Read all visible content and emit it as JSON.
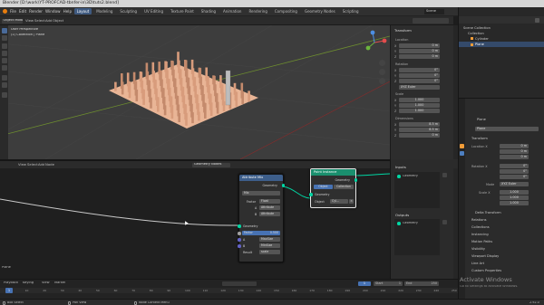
{
  "window": {
    "title": "Blender [D:\\work\\YT-PROFCAD-tbnfer-in\\3D\\tuts2.blend]"
  },
  "menubar": {
    "items": [
      "File",
      "Edit",
      "Render",
      "Window",
      "Help"
    ],
    "workspaces": [
      "Layout",
      "Modeling",
      "Sculpting",
      "UV Editing",
      "Texture Paint",
      "Shading",
      "Animation",
      "Rendering",
      "Compositing",
      "Geometry Nodes",
      "Scripting"
    ],
    "active_workspace": "Layout",
    "scene": "Scene",
    "view_layer": "View Layer"
  },
  "viewport": {
    "mode": "Object Mode",
    "menus": [
      "View",
      "Select",
      "Add",
      "Object"
    ],
    "overlay_title": "User Perspective",
    "overlay_subtitle": "(1) Collection | Plane"
  },
  "npanel": {
    "header": "Transform",
    "location_label": "Location",
    "location": [
      {
        "axis": "X",
        "value": "0 m"
      },
      {
        "axis": "Y",
        "value": "0 m"
      },
      {
        "axis": "Z",
        "value": "0 m"
      }
    ],
    "rotation_label": "Rotation",
    "rotation": [
      {
        "axis": "X",
        "value": "0°"
      },
      {
        "axis": "Y",
        "value": "0°"
      },
      {
        "axis": "Z",
        "value": "0°"
      }
    ],
    "rotation_mode": "XYZ Euler",
    "scale_label": "Scale",
    "scale": [
      {
        "axis": "X",
        "value": "1.000"
      },
      {
        "axis": "Y",
        "value": "1.000"
      },
      {
        "axis": "Z",
        "value": "1.000"
      }
    ],
    "dimensions_label": "Dimensions",
    "dimensions": [
      {
        "axis": "X",
        "value": "8.5 m"
      },
      {
        "axis": "Y",
        "value": "8.5 m"
      },
      {
        "axis": "Z",
        "value": "0 m"
      }
    ]
  },
  "outliner": {
    "items": [
      "Scene Collection",
      "Collection",
      "Cylinder",
      "Plane"
    ],
    "selected": "Plane"
  },
  "properties": {
    "object_name": "Plane",
    "data_name": "Plane",
    "transform_header": "Transform",
    "location_label": "Location X",
    "location": [
      "0 m",
      "0 m",
      "0 m"
    ],
    "rotation_label": "Rotation X",
    "rotation": [
      "0°",
      "0°",
      "0°"
    ],
    "mode_label": "Mode",
    "mode": "XYZ Euler",
    "scale_label": "Scale X",
    "scale": [
      "1.000",
      "1.000",
      "1.000"
    ],
    "sections": [
      "Delta Transform",
      "Relations",
      "Collections",
      "Instancing",
      "Motion Paths",
      "Visibility",
      "Viewport Display",
      "Line Art",
      "Custom Properties"
    ]
  },
  "node_editor": {
    "menus": [
      "View",
      "Select",
      "Add",
      "Node"
    ],
    "tree_name": "Geometry Nodes",
    "attribute_node": {
      "title": "Attribute Mix",
      "output": "Geometry",
      "blend": "Mix",
      "factor_type": "Factor",
      "factor_mode": "Float",
      "a_type": "A",
      "a_mode": "Attribute",
      "b_type": "B",
      "b_mode": "Attribute",
      "geometry": "Geometry",
      "factor_label": "Factor",
      "factor_value": "0.500",
      "a_value": "MaxSize",
      "b_value": "MinSize",
      "result_label": "Result",
      "result_value": "scale"
    },
    "instance_node": {
      "title": "Point Instance",
      "output": "Geometry",
      "tab_object": "Object",
      "tab_collection": "Collection",
      "geometry": "Geometry",
      "object_label": "Object",
      "object_value": "Cyl..."
    },
    "inputs_header": "Inputs",
    "inputs_items": [
      "Geometry"
    ],
    "outputs_header": "Outputs",
    "outputs_items": [
      "Geometry"
    ],
    "frame_label": "Plane"
  },
  "timeline": {
    "menus": [
      "Playback",
      "Keying",
      "View",
      "Marker"
    ],
    "current_frame": "1",
    "start_label": "Start",
    "start": "1",
    "end_label": "End",
    "end": "250",
    "ruler": [
      "0",
      "10",
      "20",
      "30",
      "40",
      "50",
      "60",
      "70",
      "80",
      "90",
      "100",
      "110",
      "120",
      "130",
      "140",
      "150",
      "160",
      "170",
      "180",
      "190",
      "200",
      "210",
      "220",
      "230",
      "240",
      "250"
    ]
  },
  "statusbar": {
    "select": "Box Select",
    "pan": "Pan View",
    "context": "Node Context Menu",
    "version": "2.92.0"
  },
  "watermark": {
    "title": "Activate Windows",
    "subtitle": "Go to Settings to activate Windows."
  },
  "colors": {
    "accent": "#3f5a80",
    "selection": "#f19c38",
    "geometry_socket": "#00d6a3",
    "point_instance_header": "#1a8f6e",
    "attribute_header": "#3d5e8a"
  }
}
